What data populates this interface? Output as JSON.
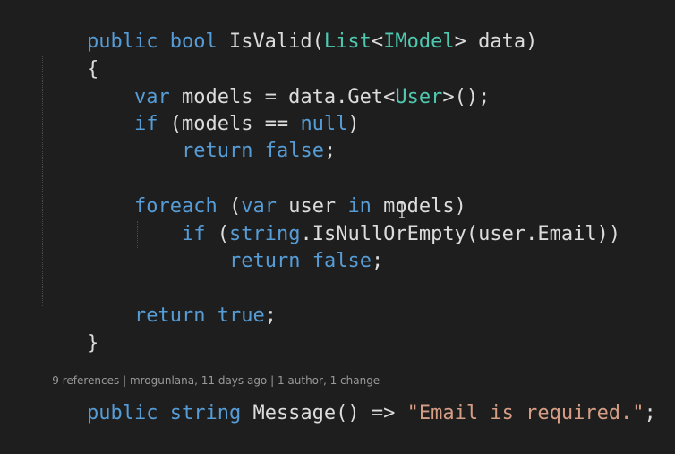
{
  "code_lens_top": "",
  "code": {
    "line1": {
      "kw1": "public",
      "sp1": " ",
      "kw2": "bool",
      "name": " IsValid(",
      "type1": "List",
      "lt": "<",
      "type2": "IModel",
      "rest": "> data)"
    },
    "line2": {
      "text": "{"
    },
    "line3": {
      "kw": "var",
      "mid": " models = data.Get<",
      "type": "User",
      "end": ">();"
    },
    "line4": {
      "kw": "if",
      "mid": " (models == ",
      "kw2": "null",
      "end": ")"
    },
    "line5": {
      "kw": "return",
      "sp": " ",
      "kw2": "false",
      "end": ";"
    },
    "line6": {
      "kw": "foreach",
      "mid1": " (",
      "kw2": "var",
      "mid2": " user ",
      "kw3": "in",
      "end": " models)"
    },
    "line7": {
      "kw": "if",
      "mid": " (",
      "kw2": "string",
      "end": ".IsNullOrEmpty(user.Email))"
    },
    "line8": {
      "kw": "return",
      "sp": " ",
      "kw2": "false",
      "end": ";"
    },
    "line9": {
      "kw": "return",
      "sp": " ",
      "kw2": "true",
      "end": ";"
    },
    "line10": {
      "text": "}"
    },
    "line11": {
      "kw1": "public",
      "sp1": " ",
      "kw2": "string",
      "mid": " Message() => ",
      "str": "\"Email is required.\"",
      "end": ";"
    }
  },
  "code_lens": {
    "references": "9 references",
    "sep1": " | ",
    "author_time": "mrogunlana, 11 days ago",
    "sep2": " | ",
    "changes": "1 author, 1 change"
  },
  "colors": {
    "background": "#1e1e1e",
    "keyword": "#569cd6",
    "type": "#4ec9b0",
    "string": "#d69d85",
    "text": "#dcdcdc"
  },
  "icons": {
    "cursor": "i-beam-cursor-icon"
  }
}
